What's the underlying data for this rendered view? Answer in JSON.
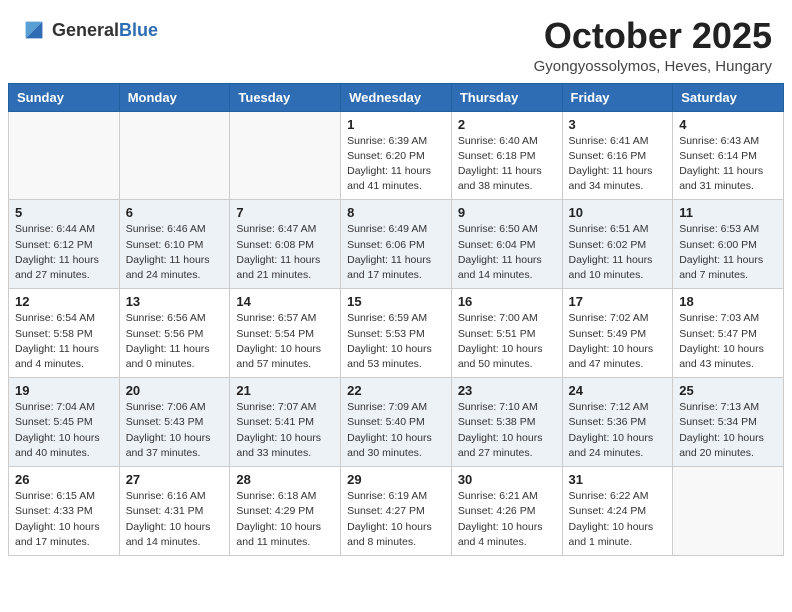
{
  "header": {
    "logo_general": "General",
    "logo_blue": "Blue",
    "month_title": "October 2025",
    "subtitle": "Gyongyossolymos, Heves, Hungary"
  },
  "days_of_week": [
    "Sunday",
    "Monday",
    "Tuesday",
    "Wednesday",
    "Thursday",
    "Friday",
    "Saturday"
  ],
  "weeks": [
    {
      "days": [
        {
          "number": "",
          "info": ""
        },
        {
          "number": "",
          "info": ""
        },
        {
          "number": "",
          "info": ""
        },
        {
          "number": "1",
          "info": "Sunrise: 6:39 AM\nSunset: 6:20 PM\nDaylight: 11 hours\nand 41 minutes."
        },
        {
          "number": "2",
          "info": "Sunrise: 6:40 AM\nSunset: 6:18 PM\nDaylight: 11 hours\nand 38 minutes."
        },
        {
          "number": "3",
          "info": "Sunrise: 6:41 AM\nSunset: 6:16 PM\nDaylight: 11 hours\nand 34 minutes."
        },
        {
          "number": "4",
          "info": "Sunrise: 6:43 AM\nSunset: 6:14 PM\nDaylight: 11 hours\nand 31 minutes."
        }
      ]
    },
    {
      "days": [
        {
          "number": "5",
          "info": "Sunrise: 6:44 AM\nSunset: 6:12 PM\nDaylight: 11 hours\nand 27 minutes."
        },
        {
          "number": "6",
          "info": "Sunrise: 6:46 AM\nSunset: 6:10 PM\nDaylight: 11 hours\nand 24 minutes."
        },
        {
          "number": "7",
          "info": "Sunrise: 6:47 AM\nSunset: 6:08 PM\nDaylight: 11 hours\nand 21 minutes."
        },
        {
          "number": "8",
          "info": "Sunrise: 6:49 AM\nSunset: 6:06 PM\nDaylight: 11 hours\nand 17 minutes."
        },
        {
          "number": "9",
          "info": "Sunrise: 6:50 AM\nSunset: 6:04 PM\nDaylight: 11 hours\nand 14 minutes."
        },
        {
          "number": "10",
          "info": "Sunrise: 6:51 AM\nSunset: 6:02 PM\nDaylight: 11 hours\nand 10 minutes."
        },
        {
          "number": "11",
          "info": "Sunrise: 6:53 AM\nSunset: 6:00 PM\nDaylight: 11 hours\nand 7 minutes."
        }
      ]
    },
    {
      "days": [
        {
          "number": "12",
          "info": "Sunrise: 6:54 AM\nSunset: 5:58 PM\nDaylight: 11 hours\nand 4 minutes."
        },
        {
          "number": "13",
          "info": "Sunrise: 6:56 AM\nSunset: 5:56 PM\nDaylight: 11 hours\nand 0 minutes."
        },
        {
          "number": "14",
          "info": "Sunrise: 6:57 AM\nSunset: 5:54 PM\nDaylight: 10 hours\nand 57 minutes."
        },
        {
          "number": "15",
          "info": "Sunrise: 6:59 AM\nSunset: 5:53 PM\nDaylight: 10 hours\nand 53 minutes."
        },
        {
          "number": "16",
          "info": "Sunrise: 7:00 AM\nSunset: 5:51 PM\nDaylight: 10 hours\nand 50 minutes."
        },
        {
          "number": "17",
          "info": "Sunrise: 7:02 AM\nSunset: 5:49 PM\nDaylight: 10 hours\nand 47 minutes."
        },
        {
          "number": "18",
          "info": "Sunrise: 7:03 AM\nSunset: 5:47 PM\nDaylight: 10 hours\nand 43 minutes."
        }
      ]
    },
    {
      "days": [
        {
          "number": "19",
          "info": "Sunrise: 7:04 AM\nSunset: 5:45 PM\nDaylight: 10 hours\nand 40 minutes."
        },
        {
          "number": "20",
          "info": "Sunrise: 7:06 AM\nSunset: 5:43 PM\nDaylight: 10 hours\nand 37 minutes."
        },
        {
          "number": "21",
          "info": "Sunrise: 7:07 AM\nSunset: 5:41 PM\nDaylight: 10 hours\nand 33 minutes."
        },
        {
          "number": "22",
          "info": "Sunrise: 7:09 AM\nSunset: 5:40 PM\nDaylight: 10 hours\nand 30 minutes."
        },
        {
          "number": "23",
          "info": "Sunrise: 7:10 AM\nSunset: 5:38 PM\nDaylight: 10 hours\nand 27 minutes."
        },
        {
          "number": "24",
          "info": "Sunrise: 7:12 AM\nSunset: 5:36 PM\nDaylight: 10 hours\nand 24 minutes."
        },
        {
          "number": "25",
          "info": "Sunrise: 7:13 AM\nSunset: 5:34 PM\nDaylight: 10 hours\nand 20 minutes."
        }
      ]
    },
    {
      "days": [
        {
          "number": "26",
          "info": "Sunrise: 6:15 AM\nSunset: 4:33 PM\nDaylight: 10 hours\nand 17 minutes."
        },
        {
          "number": "27",
          "info": "Sunrise: 6:16 AM\nSunset: 4:31 PM\nDaylight: 10 hours\nand 14 minutes."
        },
        {
          "number": "28",
          "info": "Sunrise: 6:18 AM\nSunset: 4:29 PM\nDaylight: 10 hours\nand 11 minutes."
        },
        {
          "number": "29",
          "info": "Sunrise: 6:19 AM\nSunset: 4:27 PM\nDaylight: 10 hours\nand 8 minutes."
        },
        {
          "number": "30",
          "info": "Sunrise: 6:21 AM\nSunset: 4:26 PM\nDaylight: 10 hours\nand 4 minutes."
        },
        {
          "number": "31",
          "info": "Sunrise: 6:22 AM\nSunset: 4:24 PM\nDaylight: 10 hours\nand 1 minute."
        },
        {
          "number": "",
          "info": ""
        }
      ]
    }
  ]
}
